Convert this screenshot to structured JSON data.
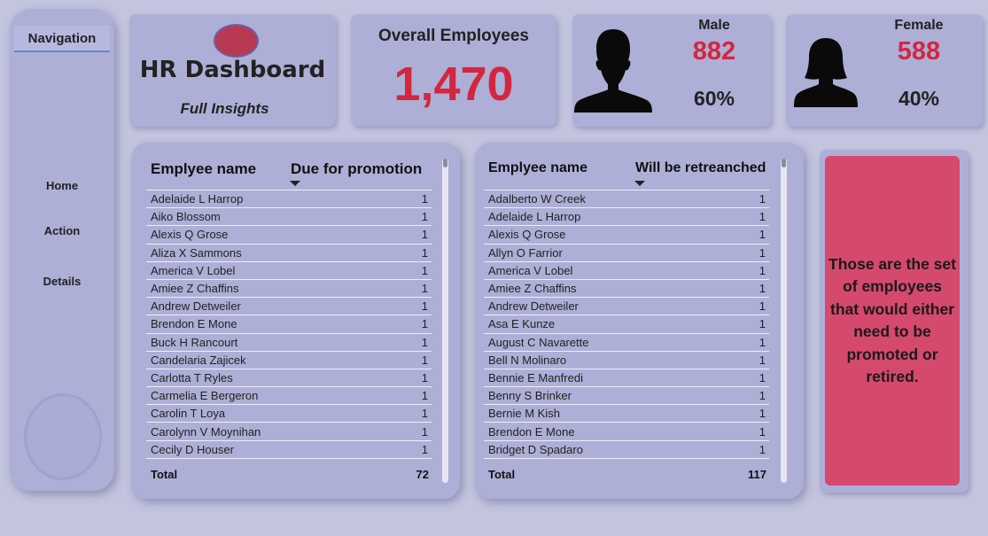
{
  "navigation": {
    "title": "Navigation",
    "items": [
      {
        "label": "Home"
      },
      {
        "label": "Action"
      },
      {
        "label": "Details"
      }
    ]
  },
  "header": {
    "title": "HR Dashboard",
    "subtitle": "Full Insights"
  },
  "overall": {
    "label": "Overall Employees",
    "value": "1,470"
  },
  "male": {
    "label": "Male",
    "count": "882",
    "percent": "60%",
    "icon": "male-silhouette-icon"
  },
  "female": {
    "label": "Female",
    "count": "588",
    "percent": "40%",
    "icon": "female-silhouette-icon"
  },
  "promotion_table": {
    "col_name": "Emplyee name",
    "col_value": "Due for promotion",
    "rows": [
      {
        "name": "Adelaide L Harrop",
        "value": "1"
      },
      {
        "name": "Aiko Blossom",
        "value": "1"
      },
      {
        "name": "Alexis Q Grose",
        "value": "1"
      },
      {
        "name": "Aliza X Sammons",
        "value": "1"
      },
      {
        "name": "America V Lobel",
        "value": "1"
      },
      {
        "name": "Amiee Z Chaffins",
        "value": "1"
      },
      {
        "name": "Andrew Detweiler",
        "value": "1"
      },
      {
        "name": "Brendon E Mone",
        "value": "1"
      },
      {
        "name": "Buck H Rancourt",
        "value": "1"
      },
      {
        "name": "Candelaria Zajicek",
        "value": "1"
      },
      {
        "name": "Carlotta T Ryles",
        "value": "1"
      },
      {
        "name": "Carmelia E Bergeron",
        "value": "1"
      },
      {
        "name": "Carolin T Loya",
        "value": "1"
      },
      {
        "name": "Carolynn V Moynihan",
        "value": "1"
      },
      {
        "name": "Cecily D Houser",
        "value": "1"
      }
    ],
    "total_label": "Total",
    "total_value": "72"
  },
  "retrenchment_table": {
    "col_name": "Emplyee name",
    "col_value": "Will be retreanched",
    "rows": [
      {
        "name": "Adalberto W Creek",
        "value": "1"
      },
      {
        "name": "Adelaide L Harrop",
        "value": "1"
      },
      {
        "name": "Alexis Q Grose",
        "value": "1"
      },
      {
        "name": "Allyn O Farrior",
        "value": "1"
      },
      {
        "name": "America V Lobel",
        "value": "1"
      },
      {
        "name": "Amiee Z Chaffins",
        "value": "1"
      },
      {
        "name": "Andrew Detweiler",
        "value": "1"
      },
      {
        "name": "Asa E Kunze",
        "value": "1"
      },
      {
        "name": "August C Navarette",
        "value": "1"
      },
      {
        "name": "Bell N Molinaro",
        "value": "1"
      },
      {
        "name": "Bennie E Manfredi",
        "value": "1"
      },
      {
        "name": "Benny S Brinker",
        "value": "1"
      },
      {
        "name": "Bernie M Kish",
        "value": "1"
      },
      {
        "name": "Brendon E Mone",
        "value": "1"
      },
      {
        "name": "Bridget D Spadaro",
        "value": "1"
      }
    ],
    "total_label": "Total",
    "total_value": "117"
  },
  "note": {
    "text": "Those are the set of employees that would either need to be promoted or retired."
  },
  "colors": {
    "background": "#c3c4de",
    "panel": "#adafd6",
    "accent_red": "#d4263f",
    "note_bg": "#d5496d"
  }
}
